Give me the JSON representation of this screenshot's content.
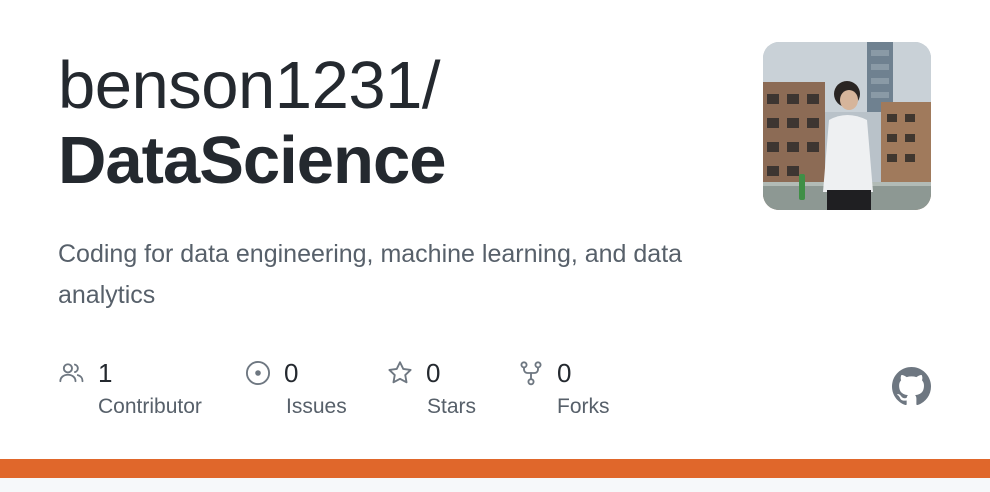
{
  "repo": {
    "owner": "benson1231/",
    "name": "DataScience",
    "description": "Coding for data engineering, machine learning, and data analytics"
  },
  "stats": [
    {
      "icon": "people-icon",
      "value": "1",
      "label": "Contributor"
    },
    {
      "icon": "issue-icon",
      "value": "0",
      "label": "Issues"
    },
    {
      "icon": "star-icon",
      "value": "0",
      "label": "Stars"
    },
    {
      "icon": "fork-icon",
      "value": "0",
      "label": "Forks"
    }
  ],
  "colors": {
    "language_bar": "#e0672b",
    "text": "#24292f",
    "muted": "#57606a",
    "icon": "#6e7781"
  },
  "icons": {
    "brand": "github-logo-icon",
    "avatar": "owner-avatar"
  }
}
